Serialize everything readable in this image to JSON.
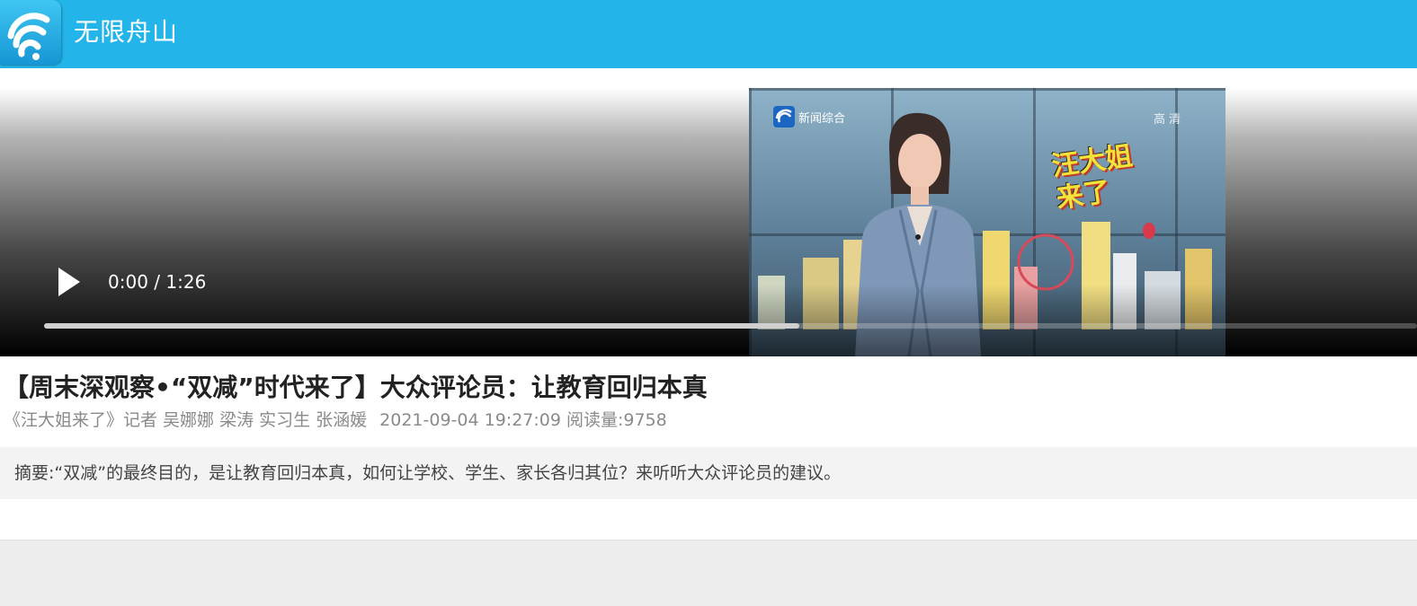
{
  "header": {
    "app_name": "无限舟山",
    "logo_icon": "wifi-signal-icon",
    "brand_color": "#23b4e9"
  },
  "video": {
    "current_time": "0:00",
    "duration": "1:26",
    "time_separator": " / ",
    "buffered_fraction": 0.55,
    "channel_label": "新闻综合",
    "hd_label": "高清",
    "show_logo_line1": "汪大姐",
    "show_logo_line2": "来了",
    "play_icon": "play-icon"
  },
  "article": {
    "title": "【周末深观察•“双减”时代来了】大众评论员：让教育回归本真",
    "byline": "《汪大姐来了》记者 吴娜娜 梁涛 实习生 张涵媛",
    "date": "2021-09-04 19:27:09",
    "views_label": "阅读量:",
    "views_count": "9758",
    "summary_label": "摘要:",
    "summary_text": "“双减”的最终目的，是让教育回归本真，如何让学校、学生、家长各归其位？来听听大众评论员的建议。"
  }
}
